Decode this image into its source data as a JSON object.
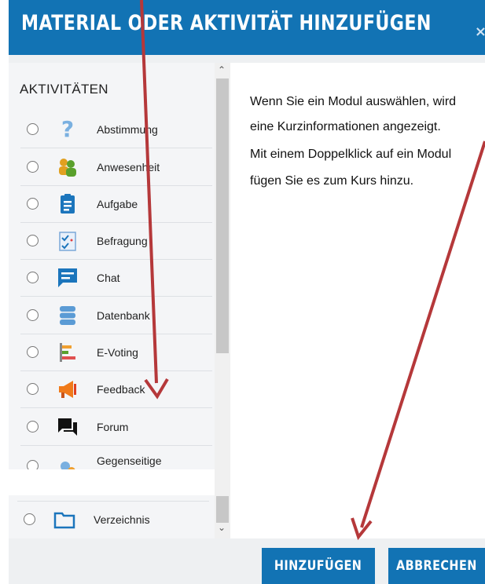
{
  "dialog": {
    "title": "MATERIAL ODER AKTIVITÄT HINZUFÜGEN",
    "close_glyph": "×"
  },
  "options": {
    "section_title": "AKTIVITÄTEN",
    "items": [
      {
        "label": "Abstimmung",
        "icon": "question-icon"
      },
      {
        "label": "Anwesenheit",
        "icon": "attendance-icon"
      },
      {
        "label": "Aufgabe",
        "icon": "assignment-icon"
      },
      {
        "label": "Befragung",
        "icon": "survey-icon"
      },
      {
        "label": "Chat",
        "icon": "chat-icon"
      },
      {
        "label": "Datenbank",
        "icon": "database-icon"
      },
      {
        "label": "E-Voting",
        "icon": "evoting-icon"
      },
      {
        "label": "Feedback",
        "icon": "megaphone-icon"
      },
      {
        "label": "Forum",
        "icon": "forum-icon"
      },
      {
        "label": "Gegenseitige",
        "icon": "workshop-icon"
      },
      {
        "label": "Verzeichnis",
        "icon": "folder-icon"
      }
    ]
  },
  "summary": {
    "lines": [
      "Wenn Sie ein Modul auswählen, wird",
      "eine Kurzinformationen angezeigt.",
      "Mit einem Doppelklick auf ein Modul",
      "fügen Sie es zum Kurs hinzu."
    ]
  },
  "footer": {
    "add_label": "HINZUFÜGEN",
    "cancel_label": "ABBRECHEN"
  },
  "colors": {
    "accent": "#1273b4",
    "annotation_arrow": "#b5383a"
  }
}
